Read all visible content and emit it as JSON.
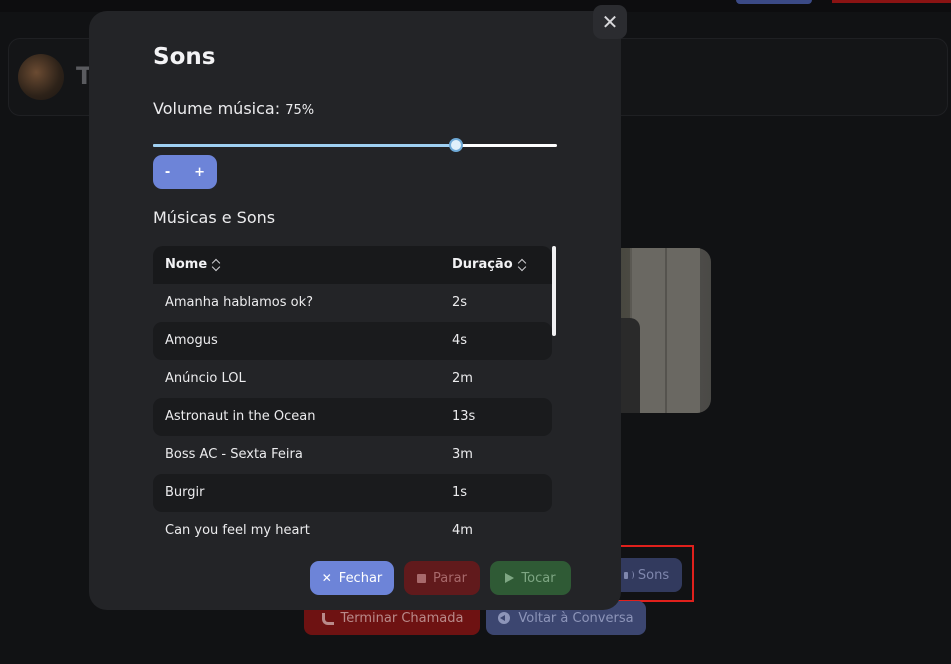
{
  "background": {
    "header_initial": "T",
    "buttons": {
      "sons_label": "Sons",
      "end_call_label": "Terminar Chamada",
      "back_label": "Voltar à Conversa"
    }
  },
  "modal": {
    "title": "Sons",
    "close_symbol": "✕",
    "volume": {
      "label": "Volume música:",
      "percent_text": "75%",
      "value_fraction": 0.75,
      "minus_label": "-",
      "plus_label": "+"
    },
    "section_title": "Músicas e Sons",
    "table": {
      "columns": [
        "Nome",
        "Duração"
      ],
      "rows": [
        {
          "name": "Amanha hablamos ok?",
          "duration": "2s"
        },
        {
          "name": "Amogus",
          "duration": "4s"
        },
        {
          "name": "Anúncio LOL",
          "duration": "2m"
        },
        {
          "name": "Astronaut in the Ocean",
          "duration": "13s"
        },
        {
          "name": "Boss AC - Sexta Feira",
          "duration": "3m"
        },
        {
          "name": "Burgir",
          "duration": "1s"
        },
        {
          "name": "Can you feel my heart",
          "duration": "4m"
        }
      ]
    },
    "buttons": {
      "close_label": "Fechar",
      "stop_label": "Parar",
      "play_label": "Tocar"
    }
  },
  "colors": {
    "accent": "#6d84d8",
    "danger": "#611a1c",
    "success": "#2f5a35",
    "highlight": "#e0201c"
  }
}
